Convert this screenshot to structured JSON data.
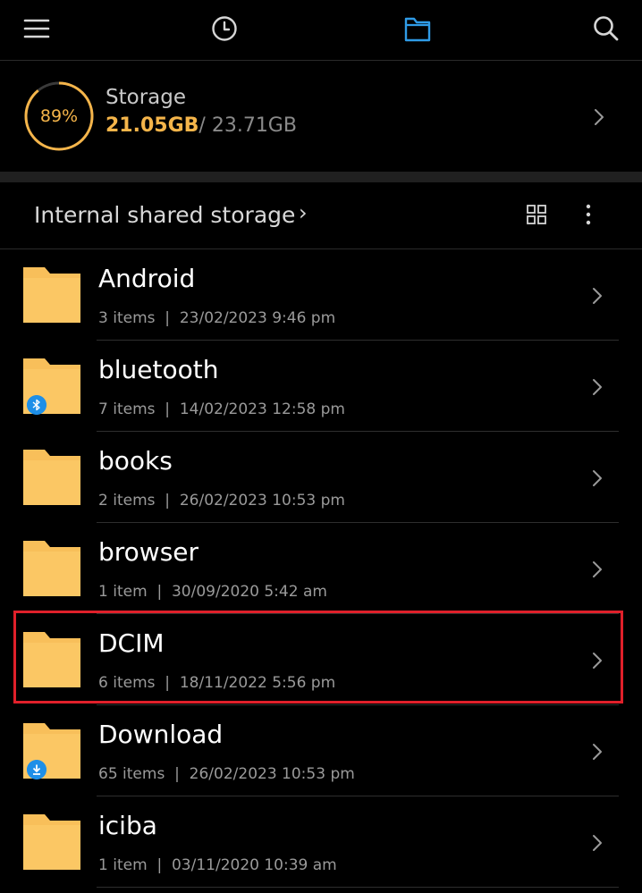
{
  "topbar": {
    "icons": [
      "menu-icon",
      "clock-icon",
      "folder-icon",
      "search-icon"
    ],
    "active": "folder-icon",
    "accent": "#2f9be6"
  },
  "storage": {
    "percent": "89%",
    "percent_value": 89,
    "title": "Storage",
    "used": "21.05GB",
    "separator": "/ ",
    "total": "23.71GB",
    "ring_color": "#f5b54a"
  },
  "path": {
    "label": "Internal shared storage",
    "chevron": "›"
  },
  "folders": [
    {
      "name": "Android",
      "count": "3 items",
      "date": "23/02/2023 9:46 pm",
      "badge": null
    },
    {
      "name": "bluetooth",
      "count": "7 items",
      "date": "14/02/2023 12:58 pm",
      "badge": "bluetooth-icon"
    },
    {
      "name": "books",
      "count": "2 items",
      "date": "26/02/2023 10:53 pm",
      "badge": null
    },
    {
      "name": "browser",
      "count": "1 item",
      "date": "30/09/2020 5:42 am",
      "badge": null
    },
    {
      "name": "DCIM",
      "count": "6 items",
      "date": "18/11/2022 5:56 pm",
      "badge": null,
      "highlighted": true
    },
    {
      "name": "Download",
      "count": "65 items",
      "date": "26/02/2023 10:53 pm",
      "badge": "download-icon"
    },
    {
      "name": "iciba",
      "count": "1 item",
      "date": "03/11/2020 10:39 am",
      "badge": null
    }
  ],
  "colors": {
    "folder": "#f8bf5a",
    "badge": "#1e8fe8",
    "highlight": "#e0202a"
  }
}
